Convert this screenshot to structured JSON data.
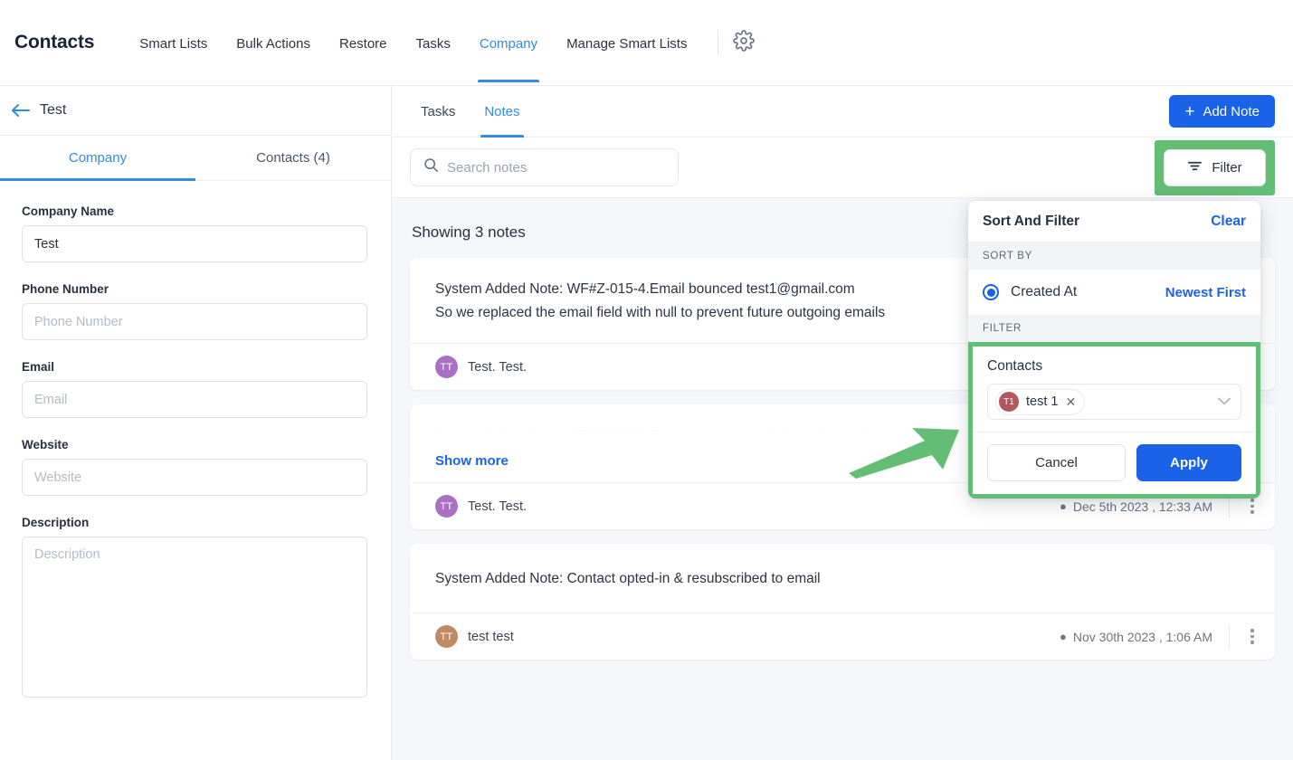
{
  "topnav": {
    "title": "Contacts",
    "items": [
      {
        "label": "Smart Lists",
        "active": false
      },
      {
        "label": "Bulk Actions",
        "active": false
      },
      {
        "label": "Restore",
        "active": false
      },
      {
        "label": "Tasks",
        "active": false
      },
      {
        "label": "Company",
        "active": true
      },
      {
        "label": "Manage Smart Lists",
        "active": false
      }
    ],
    "settings_icon": "gear-icon"
  },
  "left_panel": {
    "back_icon": "back-arrow-icon",
    "header_title": "Test",
    "tabs": [
      {
        "label": "Company",
        "active": true
      },
      {
        "label": "Contacts (4)",
        "active": false
      }
    ],
    "fields": [
      {
        "label": "Company Name",
        "value": "Test",
        "placeholder": "Company Name",
        "type": "text"
      },
      {
        "label": "Phone Number",
        "value": "",
        "placeholder": "Phone Number",
        "type": "text"
      },
      {
        "label": "Email",
        "value": "",
        "placeholder": "Email",
        "type": "text"
      },
      {
        "label": "Website",
        "value": "",
        "placeholder": "Website",
        "type": "text"
      },
      {
        "label": "Description",
        "value": "",
        "placeholder": "Description",
        "type": "textarea"
      }
    ]
  },
  "main": {
    "tabs": [
      {
        "label": "Tasks",
        "active": false
      },
      {
        "label": "Notes",
        "active": true
      }
    ],
    "add_note_label": "Add Note",
    "add_note_icon": "plus-icon",
    "search": {
      "placeholder": "Search notes",
      "value": "",
      "icon": "search-icon"
    },
    "filter_button": {
      "label": "Filter",
      "icon": "filter-icon",
      "highlighted": true
    },
    "showing_label": "Showing 3 notes",
    "notes": [
      {
        "text": "System Added Note: WF#Z-015-4.Email bounced test1@gmail.com\nSo we replaced the email field with null to prevent future outgoing emails",
        "author": "Test. Test.",
        "initials": "TT",
        "avatar_color": "#a970c4",
        "date": "",
        "show_more": false,
        "faded": false
      },
      {
        "text": "System Added Note: WF#Z-015-4.Email bounced test1@gmail.com So we",
        "author": "Test. Test.",
        "initials": "TT",
        "avatar_color": "#a970c4",
        "date": "Dec 5th 2023 , 12:33 AM",
        "show_more": true,
        "show_more_label": "Show more",
        "faded": true
      },
      {
        "text": "System Added Note: Contact opted-in & resubscribed to email",
        "author": "test test",
        "initials": "TT",
        "avatar_color": "#c08a64",
        "date": "Nov 30th 2023 , 1:06 AM",
        "show_more": false,
        "faded": false
      }
    ]
  },
  "filter_popover": {
    "title": "Sort And Filter",
    "clear_label": "Clear",
    "sort_by_label": "SORT BY",
    "sort_option": {
      "label": "Created At",
      "selected": true,
      "direction": "Newest First"
    },
    "filter_label": "FILTER",
    "contacts_label": "Contacts",
    "selected_contacts": [
      {
        "label": "test 1",
        "initials": "T1",
        "avatar_color": "#b5565c"
      }
    ],
    "cancel_label": "Cancel",
    "apply_label": "Apply",
    "caret_icon": "chevron-down-icon",
    "remove_icon": "close-icon"
  },
  "annotations": {
    "highlight_color": "#63bd74",
    "arrow_icon": "arrow-pointer-annotation"
  },
  "colors": {
    "accent_blue": "#1a63e8",
    "tab_blue": "#2f8de4",
    "highlight_green": "#63bd74",
    "page_bg": "#f5f7fa"
  }
}
